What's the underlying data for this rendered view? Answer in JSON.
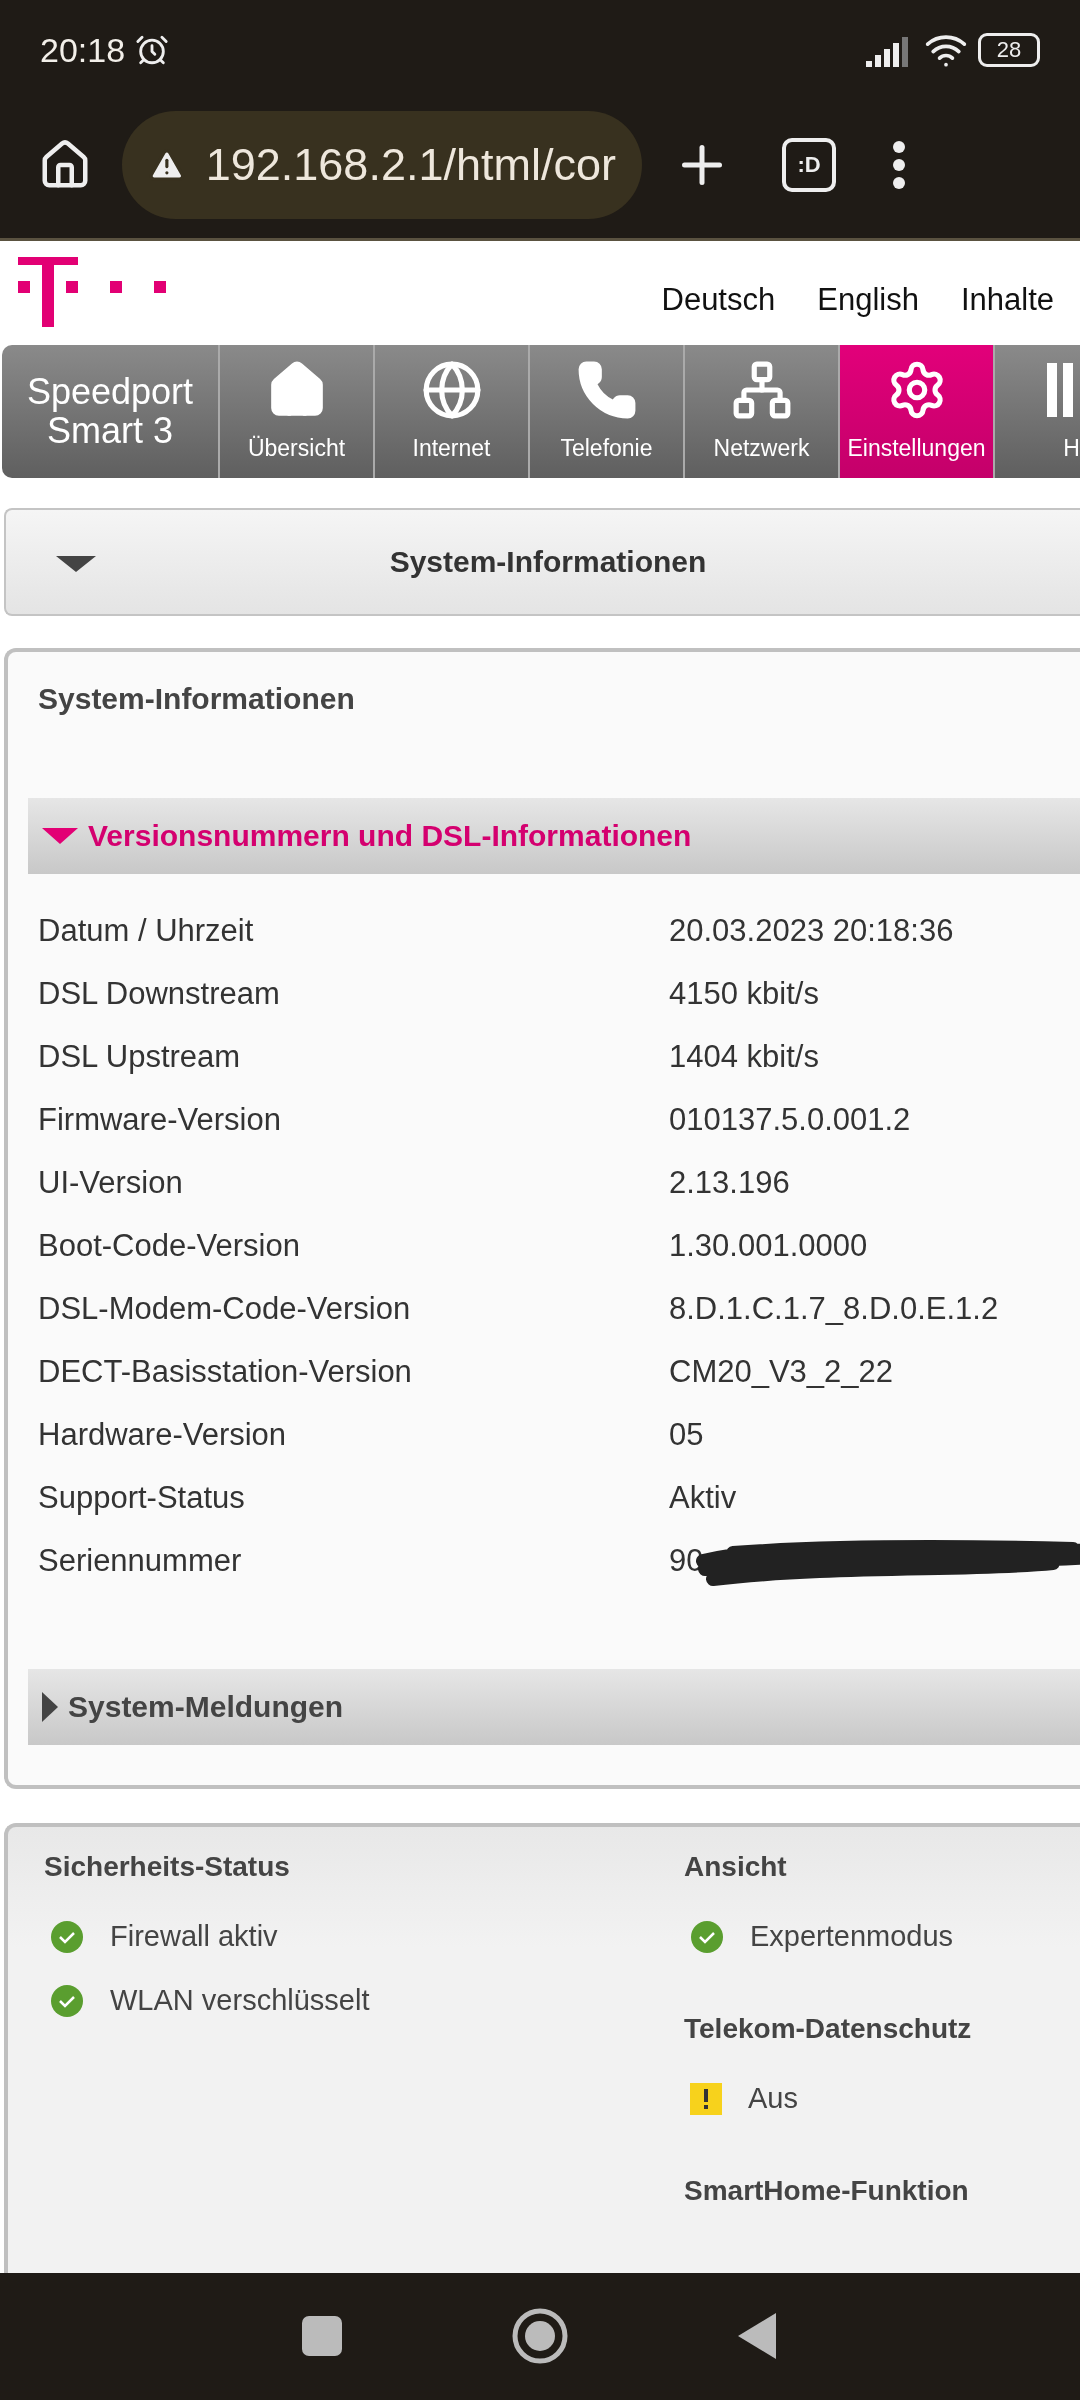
{
  "status_bar": {
    "time": "20:18",
    "battery": "28"
  },
  "browser": {
    "url": "192.168.2.1/html/cor",
    "tabs_button": ":D"
  },
  "header": {
    "links": [
      "Deutsch",
      "English",
      "Inhalte"
    ]
  },
  "nav": {
    "brand": "Speedport Smart 3",
    "tabs": [
      {
        "label": "Übersicht",
        "kind": "house",
        "selected": false
      },
      {
        "label": "Internet",
        "kind": "globe",
        "selected": false
      },
      {
        "label": "Telefonie",
        "kind": "phone",
        "selected": false
      },
      {
        "label": "Netzwerk",
        "kind": "network",
        "selected": false
      },
      {
        "label": "Einstellungen",
        "kind": "gear",
        "selected": true
      },
      {
        "label": "H",
        "kind": "panel",
        "selected": false
      }
    ]
  },
  "section_header": {
    "title": "System-Informationen",
    "expanded": true
  },
  "panel": {
    "title": "System-Informationen",
    "groups": [
      {
        "title": "Versionsnummern und DSL-Informationen",
        "expanded": true,
        "rows": [
          {
            "label": "Datum / Uhrzeit",
            "value": "20.03.2023 20:18:36"
          },
          {
            "label": "DSL Downstream",
            "value": "4150 kbit/s"
          },
          {
            "label": "DSL Upstream",
            "value": "1404 kbit/s"
          },
          {
            "label": "Firmware-Version",
            "value": "010137.5.0.001.2"
          },
          {
            "label": "UI-Version",
            "value": "2.13.196"
          },
          {
            "label": "Boot-Code-Version",
            "value": "1.30.001.0000"
          },
          {
            "label": "DSL-Modem-Code-Version",
            "value": "8.D.1.C.1.7_8.D.0.E.1.2"
          },
          {
            "label": "DECT-Basisstation-Version",
            "value": "CM20_V3_2_22"
          },
          {
            "label": "Hardware-Version",
            "value": "05"
          },
          {
            "label": "Support-Status",
            "value": "Aktiv"
          },
          {
            "label": "Seriennummer",
            "value": "90",
            "redacted": true
          }
        ]
      },
      {
        "title": "System-Meldungen",
        "expanded": false
      }
    ]
  },
  "status_panel": {
    "columns": [
      [
        {
          "title": "Sicherheits-Status",
          "items": [
            {
              "label": "Firewall aktiv",
              "kind": "ok"
            },
            {
              "label": "WLAN verschlüsselt",
              "kind": "ok"
            }
          ]
        }
      ],
      [
        {
          "title": "Ansicht",
          "items": [
            {
              "label": "Expertenmodus",
              "kind": "ok"
            }
          ]
        },
        {
          "title": "Telekom-Datenschutz",
          "items": [
            {
              "label": "Aus",
              "kind": "warning"
            }
          ]
        },
        {
          "title": "SmartHome-Funktion"
        }
      ]
    ]
  }
}
